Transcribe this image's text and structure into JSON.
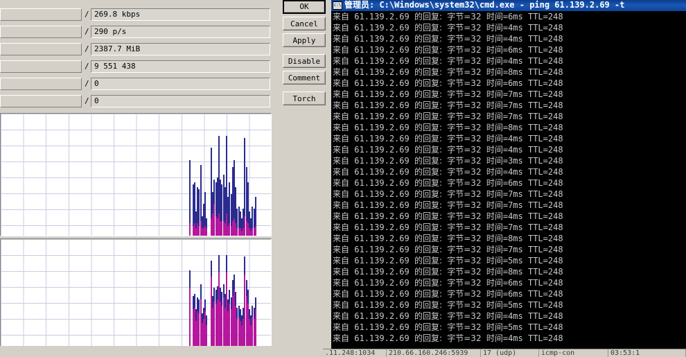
{
  "dialog": {
    "fields": [
      {
        "name": "rate",
        "separator": "/",
        "value": "269.8 kbps",
        "left_value": ""
      },
      {
        "name": "packet-rate",
        "separator": "/",
        "value": "290 p/s",
        "left_value": ""
      },
      {
        "name": "bytes",
        "separator": "/",
        "value": "2387.7 MiB",
        "left_value": ""
      },
      {
        "name": "packets",
        "separator": "/",
        "value": "9 551 438",
        "left_value": ""
      },
      {
        "name": "drops",
        "separator": "/",
        "value": "0",
        "left_value": ""
      },
      {
        "name": "errors",
        "separator": "/",
        "value": "0",
        "left_value": ""
      }
    ],
    "buttons": [
      {
        "name": "ok",
        "label": "OK",
        "primary": true,
        "gap_before": false
      },
      {
        "name": "cancel",
        "label": "Cancel",
        "primary": false,
        "gap_before": false
      },
      {
        "name": "apply",
        "label": "Apply",
        "primary": false,
        "gap_before": false
      },
      {
        "name": "disable",
        "label": "Disable",
        "primary": false,
        "gap_before": true
      },
      {
        "name": "comment",
        "label": "Comment",
        "primary": false,
        "gap_before": false
      },
      {
        "name": "torch",
        "label": "Torch",
        "primary": false,
        "gap_before": true
      }
    ]
  },
  "chart_data": [
    {
      "type": "bar",
      "name": "traffic-rate-chart",
      "title": "",
      "xlabel": "",
      "ylabel": "",
      "grid": true,
      "legend": null,
      "series": [
        {
          "name": "tx-rate",
          "color": "#2b2b8f"
        },
        {
          "name": "rx-rate",
          "color": "#b5179e"
        }
      ],
      "x": [
        0,
        1,
        2,
        3,
        4,
        5,
        6,
        7,
        8,
        9,
        10,
        11,
        12,
        13,
        14,
        15,
        16,
        17,
        18,
        19,
        20,
        21,
        22,
        23,
        24,
        25,
        26,
        27,
        28,
        29,
        30,
        31,
        32,
        33,
        34,
        35,
        36,
        37,
        38,
        39,
        40,
        41,
        42,
        43,
        44,
        45,
        46,
        47,
        48,
        49,
        50,
        51,
        52,
        53,
        54,
        55
      ],
      "values_blue": [
        0,
        62,
        0,
        42,
        44,
        20,
        40,
        38,
        58,
        16,
        26,
        36,
        14,
        0,
        0,
        72,
        36,
        46,
        44,
        48,
        82,
        46,
        42,
        50,
        40,
        82,
        32,
        44,
        34,
        56,
        62,
        40,
        22,
        24,
        20,
        14,
        22,
        80,
        56,
        44,
        20,
        14,
        24,
        22,
        32,
        0,
        0,
        0,
        0,
        0,
        0,
        0,
        0,
        0,
        0,
        0
      ],
      "values_magenta": [
        0,
        10,
        0,
        8,
        10,
        6,
        10,
        8,
        12,
        6,
        6,
        8,
        6,
        0,
        0,
        14,
        18,
        26,
        16,
        14,
        18,
        12,
        12,
        12,
        10,
        18,
        8,
        10,
        8,
        12,
        14,
        10,
        6,
        6,
        6,
        4,
        6,
        16,
        12,
        10,
        6,
        4,
        6,
        6,
        8,
        0,
        0,
        0,
        0,
        0,
        0,
        0,
        0,
        0,
        0,
        0
      ],
      "ylim": [
        0,
        100
      ]
    },
    {
      "type": "bar",
      "name": "packet-rate-chart",
      "title": "",
      "xlabel": "",
      "ylabel": "",
      "grid": true,
      "legend": null,
      "series": [
        {
          "name": "tx-packets",
          "color": "#2b2b8f"
        },
        {
          "name": "rx-packets",
          "color": "#b5179e"
        }
      ],
      "x": [
        0,
        1,
        2,
        3,
        4,
        5,
        6,
        7,
        8,
        9,
        10,
        11,
        12,
        13,
        14,
        15,
        16,
        17,
        18,
        19,
        20,
        21,
        22,
        23,
        24,
        25,
        26,
        27,
        28,
        29,
        30,
        31,
        32,
        33,
        34,
        35,
        36,
        37,
        38,
        39,
        40,
        41,
        42,
        43,
        44,
        45,
        46,
        47,
        48,
        49,
        50,
        51,
        52,
        53,
        54,
        55
      ],
      "values_blue": [
        0,
        88,
        0,
        62,
        64,
        48,
        60,
        58,
        74,
        44,
        50,
        58,
        42,
        0,
        0,
        98,
        62,
        70,
        68,
        72,
        104,
        70,
        66,
        74,
        64,
        104,
        58,
        68,
        60,
        78,
        84,
        66,
        50,
        52,
        48,
        42,
        50,
        102,
        78,
        68,
        48,
        42,
        52,
        50,
        60,
        0,
        0,
        0,
        0,
        0,
        0,
        0,
        0,
        0,
        0,
        0
      ],
      "values_magenta": [
        0,
        70,
        0,
        48,
        50,
        36,
        46,
        44,
        58,
        34,
        38,
        46,
        32,
        0,
        0,
        82,
        50,
        56,
        54,
        58,
        86,
        56,
        52,
        60,
        50,
        86,
        46,
        54,
        48,
        62,
        68,
        52,
        38,
        40,
        36,
        32,
        38,
        84,
        62,
        54,
        38,
        32,
        40,
        38,
        48,
        0,
        0,
        0,
        0,
        0,
        0,
        0,
        0,
        0,
        0,
        0
      ],
      "ylim": [
        0,
        120
      ]
    }
  ],
  "cmd": {
    "icon": "console-icon",
    "title": "管理员: C:\\Windows\\system32\\cmd.exe - ping  61.139.2.69 -t",
    "reply_prefix": "来自",
    "host": "61.139.2.69",
    "reply_label": "的回复:",
    "bytes_label": "字节=32",
    "time_label": "时间",
    "ttl_label": "TTL=248",
    "lines": [
      {
        "time_ms": "6ms"
      },
      {
        "time_ms": "4ms"
      },
      {
        "time_ms": "4ms"
      },
      {
        "time_ms": "6ms"
      },
      {
        "time_ms": "4ms"
      },
      {
        "time_ms": "8ms"
      },
      {
        "time_ms": "6ms"
      },
      {
        "time_ms": "7ms"
      },
      {
        "time_ms": "7ms"
      },
      {
        "time_ms": "7ms"
      },
      {
        "time_ms": "8ms"
      },
      {
        "time_ms": "4ms"
      },
      {
        "time_ms": "4ms"
      },
      {
        "time_ms": "3ms"
      },
      {
        "time_ms": "4ms"
      },
      {
        "time_ms": "6ms"
      },
      {
        "time_ms": "7ms"
      },
      {
        "time_ms": "7ms"
      },
      {
        "time_ms": "4ms"
      },
      {
        "time_ms": "7ms"
      },
      {
        "time_ms": "8ms"
      },
      {
        "time_ms": "7ms"
      },
      {
        "time_ms": "5ms"
      },
      {
        "time_ms": "8ms"
      },
      {
        "time_ms": "6ms"
      },
      {
        "time_ms": "6ms"
      },
      {
        "time_ms": "5ms"
      },
      {
        "time_ms": "4ms"
      },
      {
        "time_ms": "5ms"
      },
      {
        "time_ms": "4ms"
      }
    ]
  },
  "status_bar": {
    "cells": [
      {
        "name": "src-address",
        "value": ".11.248:1034"
      },
      {
        "name": "dst-address",
        "value": "210.66.160.246:5939"
      },
      {
        "name": "protocol",
        "value": "17 (udp)"
      },
      {
        "name": "comment",
        "value": "icmp-con"
      },
      {
        "name": "timeout",
        "value": "03:53:1"
      }
    ]
  },
  "colors": {
    "window_face": "#d4d0c8",
    "title_blue": "#0e4496",
    "console_bg": "#000000",
    "console_text": "#c8c8c8",
    "bar_blue": "#2b2b8f",
    "bar_magenta": "#b5179e",
    "grid_line": "#c8cce0"
  }
}
